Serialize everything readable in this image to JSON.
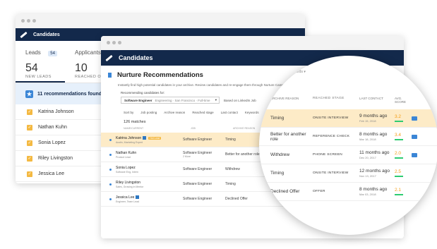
{
  "back_window": {
    "title": "Candidates",
    "tabs": [
      {
        "label": "Leads",
        "badge": "54",
        "num": "54",
        "sub": "NEW LEADS"
      },
      {
        "label": "Applicants",
        "num": "10",
        "sub": "REACHED OUT"
      }
    ],
    "rec_text": "11 recommendations found",
    "leads": [
      "Katrina Johnson",
      "Nathan Kuhn",
      "Sonia Lopez",
      "Riley Livingston",
      "Jessica Lee"
    ]
  },
  "front_window": {
    "title": "Candidates",
    "page_title": "Nurture Recommendations",
    "description": "Instantly find high potential candidates in your archive. Review candidates and re-engage them through Nurture Campaigns",
    "rec_label": "Recommending candidates for:",
    "job_select": "Software Engineer",
    "job_select_sub": "Engineering · San Francisco · Full-time",
    "based_on": "Based on LinkedIn Job",
    "filters": [
      "Sort by",
      "Job posting",
      "Archive reason",
      "Reached stage",
      "Last contact",
      "Keywords"
    ],
    "matches": "126 matches",
    "col_headers": [
      "NAME/CURRENT",
      "JOB",
      "ARCHIVE REASON"
    ],
    "candidates": [
      {
        "name": "Katrina Johnson",
        "sub": "Austin, Marketing Expert",
        "tag": "Hot Lead",
        "job": "Software Engineer",
        "reason": "Timing"
      },
      {
        "name": "Nathan Kuhn",
        "sub": "Product Lead",
        "job": "Software Engineer",
        "job_sub": "2 More",
        "reason": "Better for another role"
      },
      {
        "name": "Sonia Lopez",
        "sub": "Software Eng, Intern",
        "job": "Software Engineer",
        "reason": "Withdrew"
      },
      {
        "name": "Riley Livingston",
        "sub": "Sales, Growing in Mentor",
        "job": "Software Engineer",
        "reason": "Timing"
      },
      {
        "name": "Jessica Lee",
        "sub": "Engineer, Team Lead",
        "job": "Software Engineer",
        "reason": "Declined Offer"
      }
    ]
  },
  "magnifier": {
    "keywords": "Keywords",
    "headers": [
      "ARCHIVE REASON",
      "REACHED STAGE",
      "LAST CONTACT",
      "AVG. SCORE"
    ],
    "rows": [
      {
        "reason": "Timing",
        "stage": "ONSITE INTERVIEW",
        "contact": "9 months ago",
        "date": "Feb 15, 2018",
        "score": "3.2"
      },
      {
        "reason": "Better for another role",
        "stage": "REFERENCE CHECK",
        "contact": "8 months ago",
        "date": "Mar 18, 2018",
        "score": "3.4"
      },
      {
        "reason": "Withdrew",
        "stage": "PHONE SCREEN",
        "contact": "11 months ago",
        "date": "Dec 20, 2017",
        "score": "2.0"
      },
      {
        "reason": "Timing",
        "stage": "ONSITE INTERVIEW",
        "contact": "12 months ago",
        "date": "Nov 13, 2017",
        "score": "2.5"
      },
      {
        "reason": "Declined Offer",
        "stage": "OFFER",
        "contact": "8 months ago",
        "date": "Mar 03, 2018",
        "score": "2.1"
      }
    ]
  }
}
